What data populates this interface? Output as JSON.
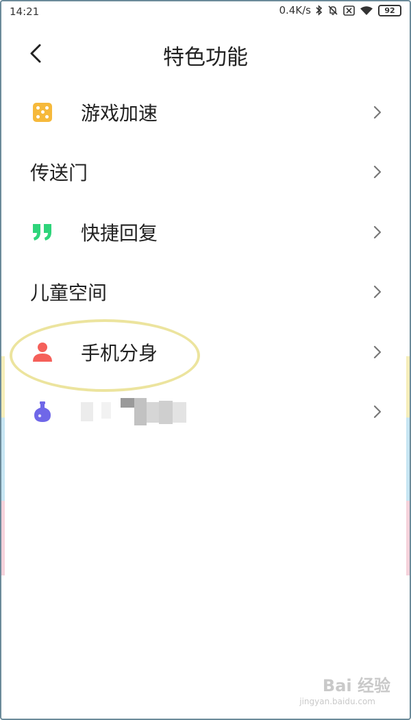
{
  "status_bar": {
    "time": "14:21",
    "network_speed": "0.4K/s",
    "battery": "92",
    "icons": [
      "bluetooth-icon",
      "mute-icon",
      "sim-disabled-icon",
      "wifi-icon",
      "battery-icon"
    ]
  },
  "header": {
    "title": "特色功能",
    "back_icon": "back-arrow-icon"
  },
  "menu": {
    "items": [
      {
        "label": "游戏加速",
        "icon": "dice-icon",
        "icon_color": "#f6b93b"
      },
      {
        "label": "传送门",
        "icon": null
      },
      {
        "label": "快捷回复",
        "icon": "quote-icon",
        "icon_color": "#2ed47a"
      },
      {
        "label": "儿童空间",
        "icon": null
      },
      {
        "label": "手机分身",
        "icon": "person-icon",
        "icon_color": "#f5605a",
        "highlighted": true
      },
      {
        "label": "",
        "icon": "potion-flask-icon",
        "icon_color": "#6f67e8",
        "blurred": true
      }
    ]
  },
  "watermark": {
    "logo": "Bai 经验",
    "url": "jingyan.baidu.com"
  },
  "colors": {
    "highlight_ellipse": "#ece49e",
    "text": "#222222",
    "chevron": "#777777"
  }
}
